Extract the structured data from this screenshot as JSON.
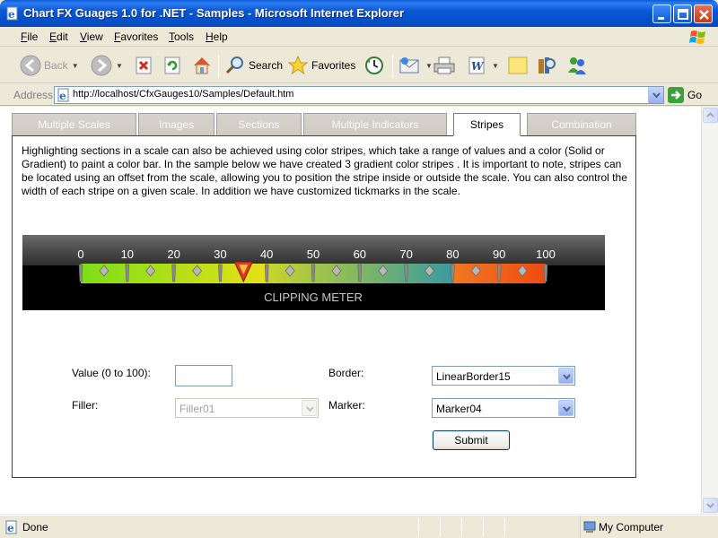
{
  "window": {
    "title": "Chart FX Guages 1.0 for .NET - Samples - Microsoft Internet Explorer",
    "titlebar_color": "#0A58D4"
  },
  "menu": {
    "items": [
      {
        "label": "File",
        "accel": "F",
        "rest": "ile"
      },
      {
        "label": "Edit",
        "accel": "E",
        "rest": "dit"
      },
      {
        "label": "View",
        "accel": "V",
        "rest": "iew"
      },
      {
        "label": "Favorites",
        "accel": "F",
        "rest": "avorites"
      },
      {
        "label": "Tools",
        "accel": "T",
        "rest": "ools"
      },
      {
        "label": "Help",
        "accel": "H",
        "rest": "elp"
      }
    ]
  },
  "toolbar": {
    "back_label": "Back",
    "search_label": "Search",
    "favorites_label": "Favorites"
  },
  "address": {
    "label": "Address",
    "url": "http://localhost/CfxGauges10/Samples/Default.htm",
    "go_label": "Go"
  },
  "tabs": [
    {
      "label": "Multiple Scales",
      "active": false
    },
    {
      "label": "Images",
      "active": false
    },
    {
      "label": "Sections",
      "active": false
    },
    {
      "label": "Multiple Indicators",
      "active": false
    },
    {
      "label": "Stripes",
      "active": true
    },
    {
      "label": "Combination",
      "active": false
    }
  ],
  "description": "Highlighting sections in a scale can also be achieved using color stripes, which take a range of values and a color (Solid or Gradient) to paint a color bar. In the sample below we have created 3 gradient color stripes . It is important to note, stripes can be located using an offset from the scale, allowing you to position the stripe inside or outside the scale. You can also control the width of each stripe on a given scale. In addition we have customized tickmarks in the scale.",
  "gauge": {
    "title": "CLIPPING METER",
    "scale_min": 0,
    "scale_max": 100,
    "tick_labels": [
      "0",
      "10",
      "20",
      "30",
      "40",
      "50",
      "60",
      "70",
      "80",
      "90",
      "100"
    ],
    "marker_value": 35,
    "stripes": [
      {
        "from": 0,
        "to": 40,
        "colors": [
          "#7CDE18",
          "#E8E018"
        ]
      },
      {
        "from": 40,
        "to": 80,
        "colors": [
          "#C8D428",
          "#3A9AA0"
        ]
      },
      {
        "from": 80,
        "to": 100,
        "colors": [
          "#F07820",
          "#F04A10"
        ]
      }
    ]
  },
  "form": {
    "value_label": "Value (0 to 100):",
    "value_input": "",
    "border_label": "Border:",
    "border_value": "LinearBorder15",
    "filler_label": "Filler:",
    "filler_value": "Filler01",
    "marker_label": "Marker:",
    "marker_value": "Marker04",
    "submit_label": "Submit"
  },
  "status": {
    "text": "Done",
    "zone": "My Computer"
  }
}
